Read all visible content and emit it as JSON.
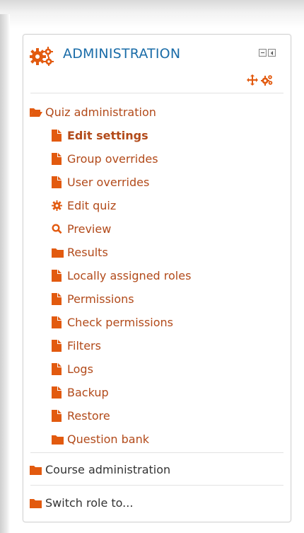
{
  "block": {
    "title": "ADMINISTRATION",
    "controls": {
      "minimize_icon": "minimize-icon",
      "dock_icon": "dock-icon",
      "move_icon": "move-icon",
      "actions_icon": "cog-icon"
    }
  },
  "nav": {
    "quiz_admin": {
      "label": "Quiz administration",
      "icon": "folder-open-icon"
    },
    "quiz_items": [
      {
        "label": "Edit settings",
        "icon": "file-icon"
      },
      {
        "label": "Group overrides",
        "icon": "file-icon"
      },
      {
        "label": "User overrides",
        "icon": "file-icon"
      },
      {
        "label": "Edit quiz",
        "icon": "gear-icon"
      },
      {
        "label": "Preview",
        "icon": "search-icon"
      },
      {
        "label": "Results",
        "icon": "folder-icon"
      },
      {
        "label": "Locally assigned roles",
        "icon": "file-icon"
      },
      {
        "label": "Permissions",
        "icon": "file-icon"
      },
      {
        "label": "Check permissions",
        "icon": "file-icon"
      },
      {
        "label": "Filters",
        "icon": "file-icon"
      },
      {
        "label": "Logs",
        "icon": "file-icon"
      },
      {
        "label": "Backup",
        "icon": "file-icon"
      },
      {
        "label": "Restore",
        "icon": "file-icon"
      },
      {
        "label": "Question bank",
        "icon": "folder-icon"
      }
    ],
    "course_admin": {
      "label": "Course administration",
      "icon": "folder-icon"
    },
    "switch_role": {
      "label": "Switch role to...",
      "icon": "folder-icon"
    }
  },
  "colors": {
    "link": "#b24a1a",
    "accent": "#1a6ca8",
    "icon": "#e25a0f"
  }
}
